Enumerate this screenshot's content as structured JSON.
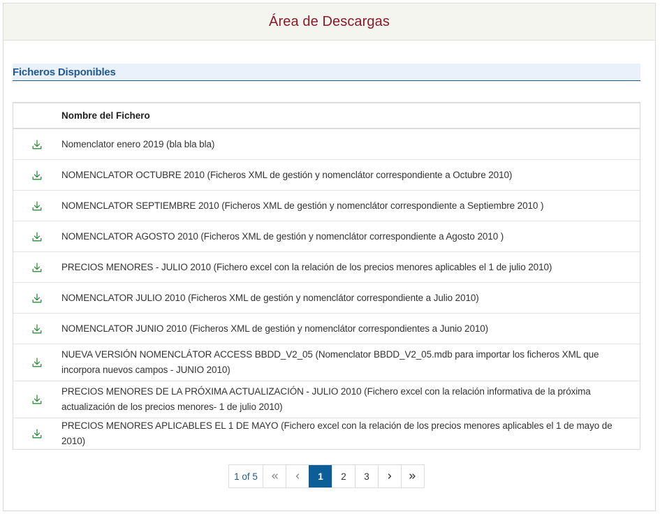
{
  "header": {
    "title": "Área de Descargas"
  },
  "section": {
    "title": "Ficheros Disponibles"
  },
  "table": {
    "column_name": "Nombre del Fichero",
    "rows": [
      {
        "name": "Nomenclator enero 2019 (bla bla bla)",
        "icon": "download-icon"
      },
      {
        "name": "NOMENCLATOR OCTUBRE 2010 (Ficheros XML de gestión y nomenclátor correspondiente a Octubre 2010)",
        "icon": "download-icon"
      },
      {
        "name": "NOMENCLATOR SEPTIEMBRE 2010 (Ficheros XML de gestión y nomenclátor correspondiente a Septiembre 2010 )",
        "icon": "download-icon"
      },
      {
        "name": "NOMENCLATOR AGOSTO 2010 (Ficheros XML de gestión y nomenclátor correspondiente a Agosto 2010 )",
        "icon": "download-icon"
      },
      {
        "name": "PRECIOS MENORES - JULIO 2010 (Fichero excel con la relación de los precios menores aplicables el 1 de julio 2010)",
        "icon": "download-icon"
      },
      {
        "name": "NOMENCLATOR JULIO 2010 (Ficheros XML de gestión y nomenclátor correspondiente a Julio 2010)",
        "icon": "download-icon"
      },
      {
        "name": "NOMENCLATOR JUNIO 2010 (Ficheros XML de gestión y nomenclátor correspondientes a Junio 2010)",
        "icon": "download-icon"
      },
      {
        "name": "NUEVA VERSIÓN NOMENCLÁTOR ACCESS BBDD_V2_05 (Nomenclator BBDD_V2_05.mdb para importar los ficheros XML que incorpora nuevos campos - JUNIO 2010)",
        "icon": "download-icon"
      },
      {
        "name": "PRECIOS MENORES DE LA PRÓXIMA ACTUALIZACIÓN - JULIO 2010 (Fichero excel con la relación informativa de la próxima actualización de los precios menores- 1 de julio 2010)",
        "icon": "download-icon"
      },
      {
        "name": "PRECIOS MENORES APLICABLES EL 1 DE MAYO (Fichero excel con la relación de los precios menores aplicables el 1 de mayo de 2010)",
        "icon": "download-icon"
      }
    ]
  },
  "pagination": {
    "info": "1 of 5",
    "first_icon": "double-chevron-left-icon",
    "prev_icon": "chevron-left-icon",
    "pages": [
      "1",
      "2",
      "3"
    ],
    "current_page": "1",
    "next_icon": "chevron-right-icon",
    "last_icon": "double-chevron-right-icon"
  },
  "colors": {
    "title": "#8b1a2b",
    "section": "#1f5a92",
    "download_icon": "#2e8b3e",
    "active_page": "#0b5e96"
  }
}
